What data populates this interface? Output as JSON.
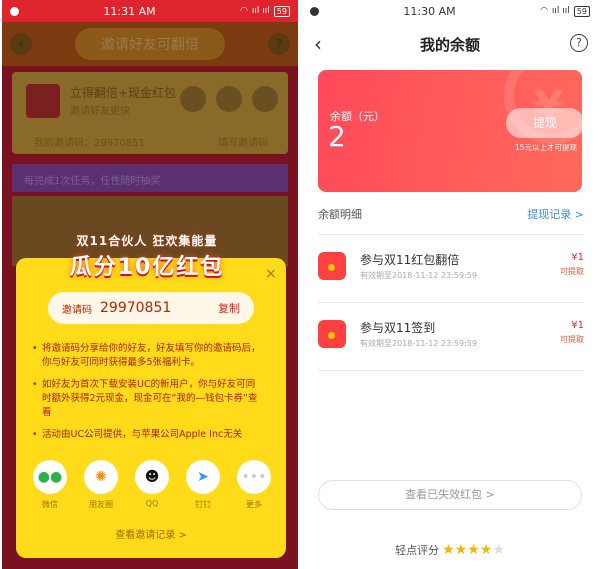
{
  "left": {
    "status": {
      "time": "11:31 AM",
      "signal": "ııl ııl",
      "battery": "59"
    },
    "bg": {
      "title": "邀请好友可翻倍",
      "card_title": "立得翻倍+现金红包",
      "card_sub": "邀请好友更快",
      "my_code_label": "我的邀请码：29970851",
      "fill_code": "填写邀请码",
      "band_text": "每完成1次任务，任性随时抽奖"
    },
    "modal": {
      "banner_top": "双11合伙人 狂欢集能量",
      "banner_main": "瓜分10亿红包",
      "close": "×",
      "invite_label": "邀请码",
      "invite_code": "29970851",
      "copy": "复制",
      "rules": [
        "将邀请码分享给你的好友，好友填写你的邀请码后，你与好友可同时获得最多5张福利卡。",
        "如好友为首次下载安装UC的新用户，你与好友可同时额外获得2元现金，现金可在“我的—钱包卡券”查看",
        "活动由UC公司提供，与苹果公司Apple Inc无关"
      ],
      "shares": [
        {
          "label": "微信",
          "icon": "wechat-icon",
          "color": "#2bb24c"
        },
        {
          "label": "朋友圈",
          "icon": "moments-icon",
          "color": "#f08c00"
        },
        {
          "label": "QQ",
          "icon": "qq-icon",
          "color": "#111111"
        },
        {
          "label": "钉钉",
          "icon": "dingtalk-icon",
          "color": "#3296fa"
        },
        {
          "label": "更多",
          "icon": "more-icon",
          "color": "#cccccc"
        }
      ],
      "records_link": "查看邀请记录 >"
    }
  },
  "right": {
    "status": {
      "time": "11:30 AM",
      "signal": "ııl ııl",
      "battery": "59"
    },
    "title": "我的余额",
    "help": "?",
    "card": {
      "label": "余额（元）",
      "amount": "2",
      "withdraw": "提现",
      "note": "15元以上才可提现"
    },
    "section_title": "余额明细",
    "section_link": "提现记录 >",
    "items": [
      {
        "title": "参与双11红包翻倍",
        "sub": "有效期至2018-11-12 23:59:59",
        "amount": "¥1",
        "status": "可提取"
      },
      {
        "title": "参与双11签到",
        "sub": "有效期至2018-11-12 23:59:59",
        "amount": "¥1",
        "status": "可提取"
      }
    ],
    "invalid_button": "查看已失效红包 >",
    "rating": {
      "label": "轻点评分",
      "value": 4,
      "max": 5
    }
  }
}
